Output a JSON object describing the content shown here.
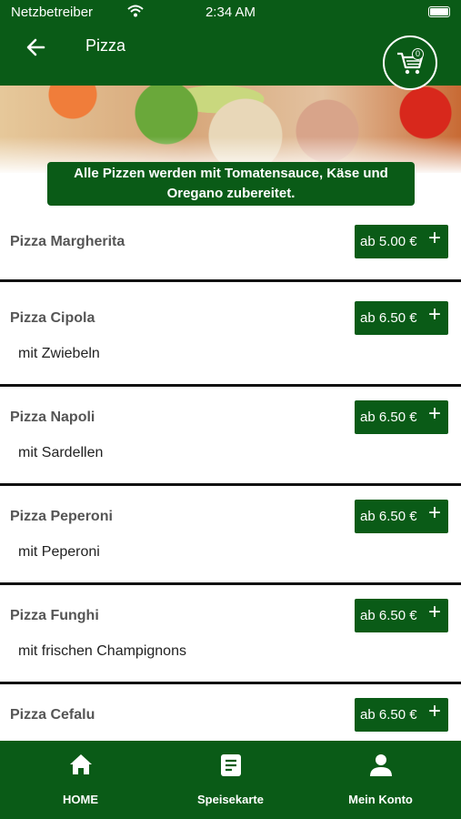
{
  "status_bar": {
    "carrier": "Netzbetreiber",
    "time": "2:34 AM"
  },
  "header": {
    "title": "Pizza",
    "cart_count": "0"
  },
  "notice": "Alle Pizzen werden mit Tomatensauce, Käse und Oregano zubereitet.",
  "menu": {
    "items": [
      {
        "name": "Pizza Margherita",
        "desc": "",
        "price": "ab 5.00 €"
      },
      {
        "name": "Pizza Cipola",
        "desc": "mit Zwiebeln",
        "price": "ab 6.50 €"
      },
      {
        "name": "Pizza Napoli",
        "desc": "mit Sardellen",
        "price": "ab 6.50 €"
      },
      {
        "name": "Pizza Peperoni",
        "desc": "mit Peperoni",
        "price": "ab 6.50 €"
      },
      {
        "name": "Pizza Funghi",
        "desc": "mit frischen Champignons",
        "price": "ab 6.50 €"
      },
      {
        "name": "Pizza Cefalu",
        "desc": "",
        "price": "ab 6.50 €"
      }
    ]
  },
  "bottom_nav": {
    "items": [
      {
        "label": "HOME",
        "icon": "home-icon"
      },
      {
        "label": "Speisekarte",
        "icon": "menu-card-icon"
      },
      {
        "label": "Mein Konto",
        "icon": "user-icon"
      }
    ]
  },
  "colors": {
    "brand_green": "#0a5b17",
    "divider": "#111111"
  }
}
